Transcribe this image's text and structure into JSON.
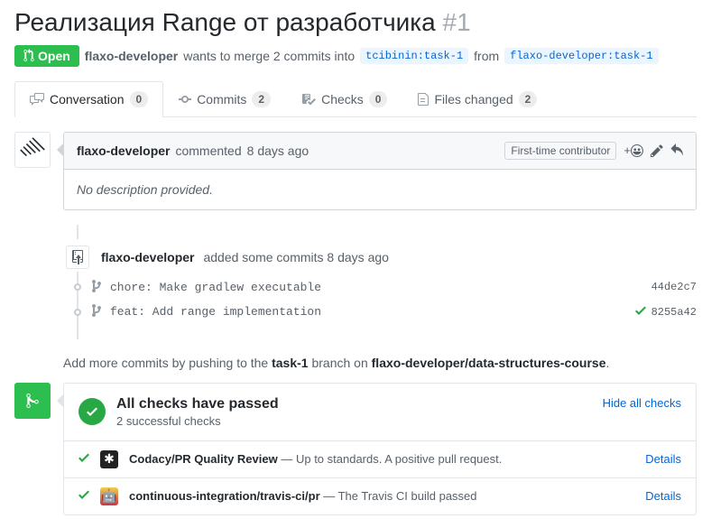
{
  "title": {
    "text": "Реализация Range от разработчика",
    "number": "#1"
  },
  "state": {
    "label": "Open"
  },
  "meta": {
    "author": "flaxo-developer",
    "wants_text": "wants to merge 2 commits into",
    "base_branch": "tcibinin:task-1",
    "from_text": "from",
    "head_branch": "flaxo-developer:task-1"
  },
  "tabs": {
    "conversation": {
      "label": "Conversation",
      "count": "0"
    },
    "commits": {
      "label": "Commits",
      "count": "2"
    },
    "checks": {
      "label": "Checks",
      "count": "0"
    },
    "files": {
      "label": "Files changed",
      "count": "2"
    }
  },
  "comment": {
    "author": "flaxo-developer",
    "action": "commented",
    "time": "8 days ago",
    "contributor_label": "First-time contributor",
    "body": "No description provided."
  },
  "commit_event": {
    "author": "flaxo-developer",
    "text": "added some commits 8 days ago"
  },
  "commits": [
    {
      "message": "chore: Make gradlew executable",
      "sha": "44de2c7",
      "passed": false
    },
    {
      "message": "feat: Add range implementation",
      "sha": "8255a42",
      "passed": true
    }
  ],
  "push_hint": {
    "prefix": "Add more commits by pushing to the ",
    "branch": "task-1",
    "mid": " branch on ",
    "repo": "flaxo-developer/data-structures-course",
    "suffix": "."
  },
  "merge_status": {
    "title": "All checks have passed",
    "subtitle": "2 successful checks",
    "hide_label": "Hide all checks",
    "checks": [
      {
        "avatar": "codacy",
        "name": "Codacy/PR Quality Review",
        "desc": " — Up to standards. A positive pull request.",
        "details": "Details"
      },
      {
        "avatar": "travis",
        "name": "continuous-integration/travis-ci/pr",
        "desc": " — The Travis CI build passed",
        "details": "Details"
      }
    ]
  }
}
